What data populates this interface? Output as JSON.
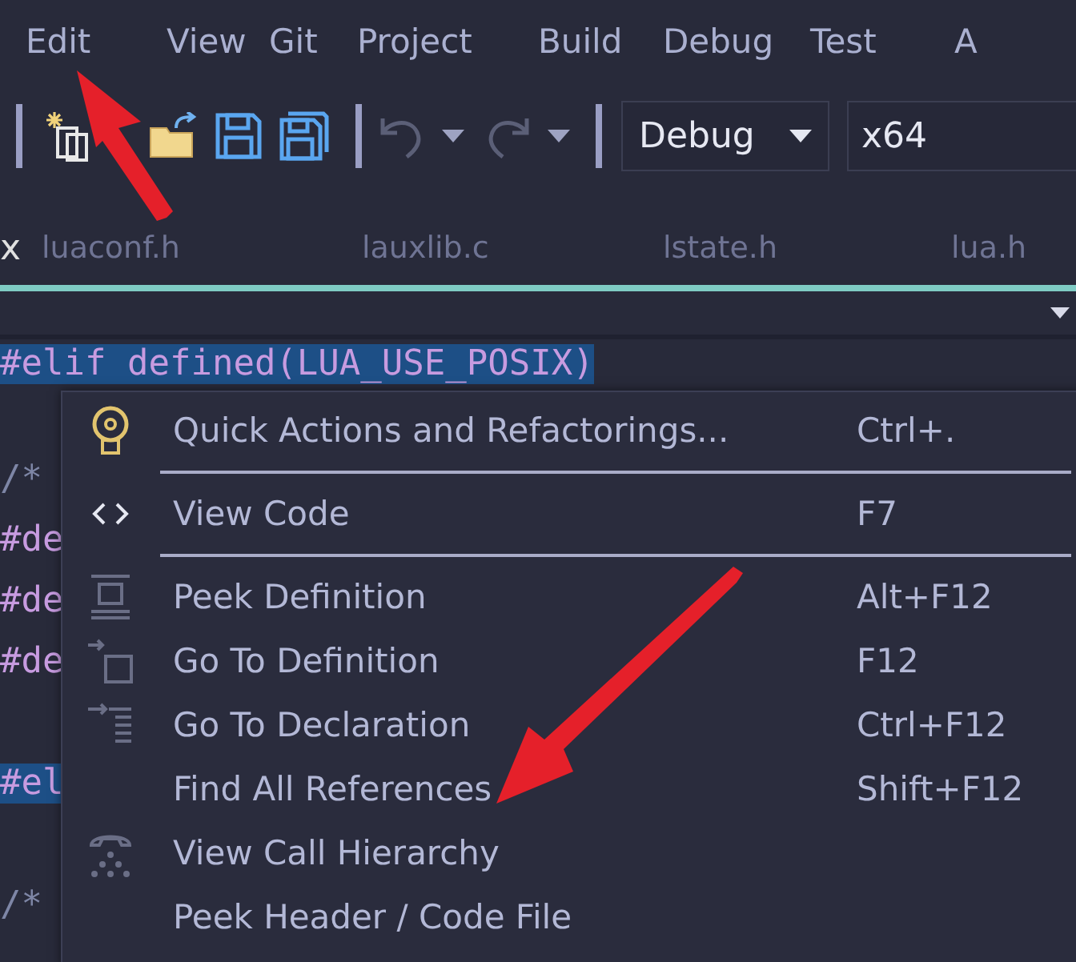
{
  "menubar": {
    "items": [
      {
        "label": "Edit"
      },
      {
        "label": "View"
      },
      {
        "label": "Git"
      },
      {
        "label": "Project"
      },
      {
        "label": "Build"
      },
      {
        "label": "Debug"
      },
      {
        "label": "Test"
      },
      {
        "label": "A"
      }
    ]
  },
  "toolbar": {
    "configuration": "Debug",
    "platform": "x64"
  },
  "tabs": [
    {
      "label": "x",
      "kind": "close"
    },
    {
      "label": "luaconf.h",
      "kind": "tab"
    },
    {
      "label": "lauxlib.c",
      "kind": "tab"
    },
    {
      "label": "lstate.h",
      "kind": "tab"
    },
    {
      "label": "lua.h",
      "kind": "tab"
    }
  ],
  "code_lines": [
    {
      "text": "#elif defined(LUA_USE_POSIX)",
      "selected": true,
      "kind": "keyword"
    },
    {
      "selected": false,
      "kind": "blank"
    },
    {
      "text": "/*",
      "selected": false,
      "kind": "comment"
    },
    {
      "text": "#de",
      "selected": false,
      "kind": "keyword"
    },
    {
      "text": "#de",
      "selected": false,
      "kind": "keyword"
    },
    {
      "text": "#de",
      "selected": false,
      "kind": "keyword"
    },
    {
      "selected": false,
      "kind": "blank"
    },
    {
      "text": "#el",
      "selected": true,
      "kind": "keyword"
    },
    {
      "selected": false,
      "kind": "blank"
    },
    {
      "text": "/*",
      "selected": false,
      "kind": "comment"
    }
  ],
  "context_menu": {
    "items": [
      {
        "label": "Quick Actions and Refactorings...",
        "shortcut": "Ctrl+.",
        "separator_after": true
      },
      {
        "label": "View Code",
        "shortcut": "F7",
        "separator_after": true
      },
      {
        "label": "Peek Definition",
        "shortcut": "Alt+F12",
        "separator_after": false
      },
      {
        "label": "Go To Definition",
        "shortcut": "F12",
        "separator_after": false
      },
      {
        "label": "Go To Declaration",
        "shortcut": "Ctrl+F12",
        "separator_after": false
      },
      {
        "label": "Find All References",
        "shortcut": "Shift+F12",
        "separator_after": false
      },
      {
        "label": "View Call Hierarchy",
        "separator_after": false
      },
      {
        "label": "Peek Header / Code File",
        "separator_after": false
      }
    ]
  }
}
